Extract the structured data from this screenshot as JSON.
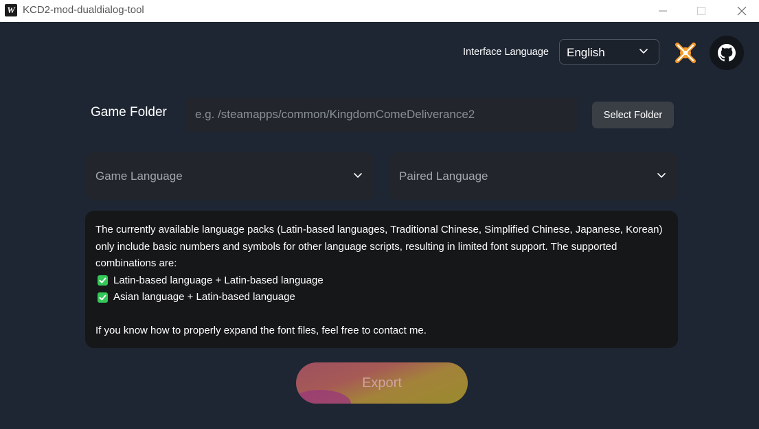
{
  "window": {
    "title": "KCD2-mod-dualdialog-tool",
    "icon_letter": "W"
  },
  "header": {
    "interface_language_label": "Interface Language",
    "interface_language_value": "English",
    "icons": [
      "chevron-down-icon",
      "nexus-mods-icon",
      "github-icon"
    ]
  },
  "folder": {
    "label": "Game Folder",
    "placeholder": "e.g. /steamapps/common/KingdomComeDeliverance2",
    "value": "",
    "button_label": "Select Folder"
  },
  "languages": {
    "game_placeholder": "Game Language",
    "paired_placeholder": "Paired Language"
  },
  "info": {
    "paragraph": "The currently available language packs (Latin-based languages, Traditional Chinese, Simplified Chinese, Japanese, Korean) only include basic numbers and symbols for other language scripts, resulting in limited font support. The supported combinations are:",
    "combos": [
      "Latin-based language + Latin-based language",
      "Asian language + Latin-based language"
    ],
    "contact": "If you know how to properly expand the font files, feel free to contact me."
  },
  "export": {
    "label": "Export"
  },
  "colors": {
    "background": "#1e2633",
    "panel": "#22262c",
    "info_panel": "#161719",
    "check_green": "#34c759"
  }
}
